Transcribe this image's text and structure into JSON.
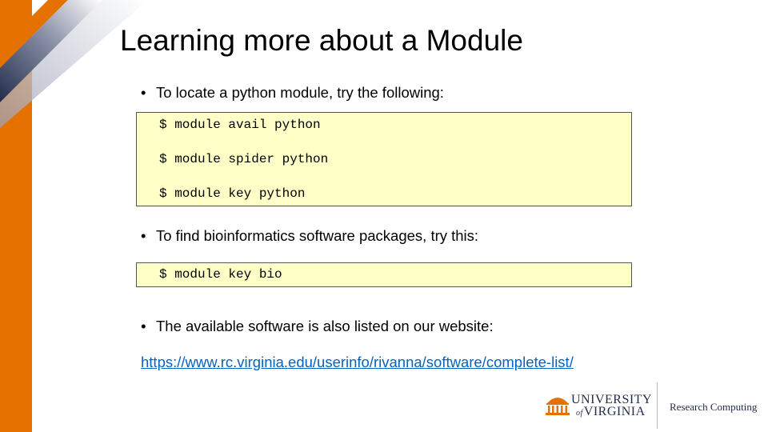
{
  "slide": {
    "title": "Learning more about a Module",
    "bullets": [
      "To locate a python module, try the following:",
      "To find bioinformatics software packages, try this:",
      "The available software is also listed on our website:"
    ],
    "code_block_1": [
      "$ module avail python",
      "$ module spider python",
      "$ module key python"
    ],
    "code_block_2": [
      "$ module key bio"
    ],
    "link": "https://www.rc.virginia.edu/userinfo/rivanna/software/complete-list/"
  },
  "footer": {
    "logo_line1": "UNIVERSITY",
    "logo_of": "of",
    "logo_line2": "VIRGINIA",
    "department": "Research Computing"
  },
  "colors": {
    "accent_orange": "#e57200",
    "navy": "#232d4b",
    "code_background": "#ffffc8",
    "link": "#0563c1"
  }
}
